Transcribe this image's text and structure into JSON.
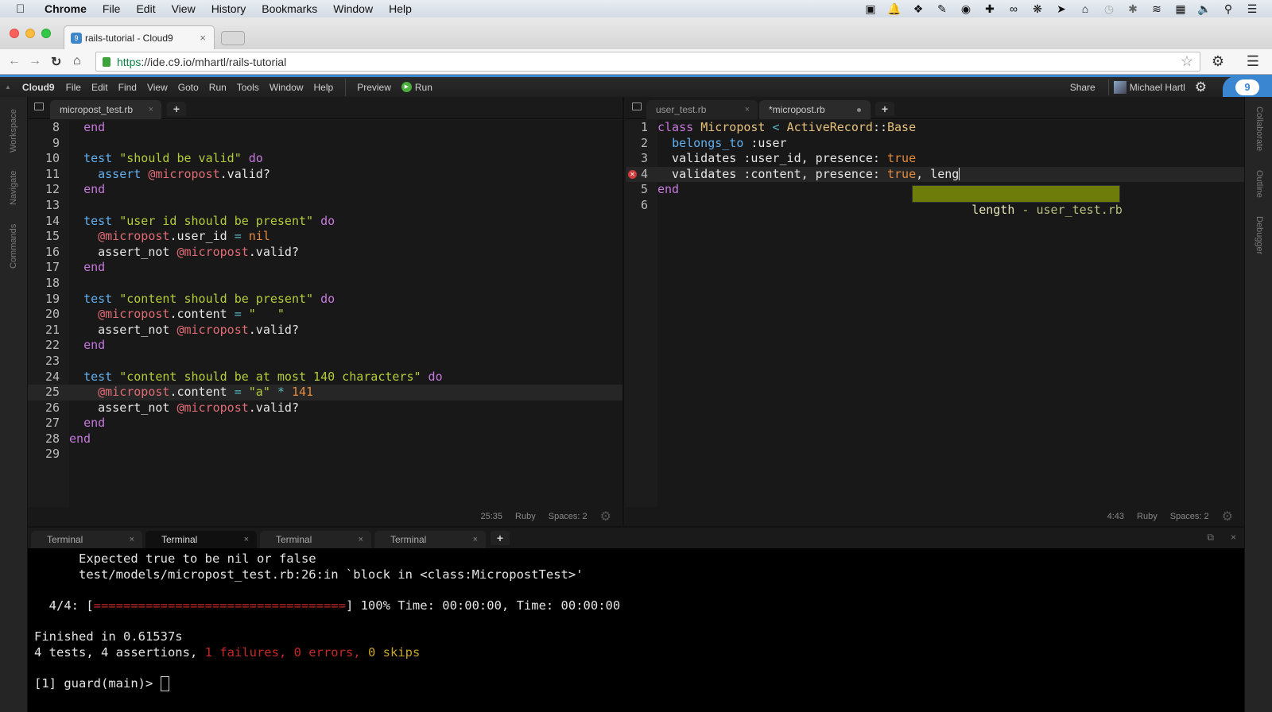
{
  "mac_menubar": {
    "app": "Chrome",
    "items": [
      "File",
      "Edit",
      "View",
      "History",
      "Bookmarks",
      "Window",
      "Help"
    ],
    "status_icons": [
      "camera-icon",
      "bell-icon",
      "dropbox-icon",
      "tools-icon",
      "bowl-icon",
      "plus-icon",
      "infinity-icon",
      "paw-icon",
      "arrow-icon",
      "home-icon",
      "time-machine-icon",
      "bluetooth-icon",
      "wifi-icon",
      "calendar-icon",
      "volume-icon",
      "search-icon",
      "list-icon"
    ]
  },
  "browser": {
    "tab_title": "rails-tutorial - Cloud9",
    "url_scheme": "https",
    "url_rest": "://ide.c9.io/mhartl/rails-tutorial"
  },
  "ide": {
    "brand": "Cloud9",
    "menu": [
      "File",
      "Edit",
      "Find",
      "View",
      "Goto",
      "Run",
      "Tools",
      "Window",
      "Help"
    ],
    "preview_label": "Preview",
    "run_label": "Run",
    "share_label": "Share",
    "user_name": "Michael Hartl",
    "left_rail": [
      "Workspace",
      "Navigate",
      "Commands"
    ],
    "right_rail": [
      "Collaborate",
      "Outline",
      "Debugger"
    ]
  },
  "left_pane": {
    "tabs": [
      {
        "label": "micropost_test.rb",
        "active": true
      }
    ],
    "status": {
      "cursor": "25:35",
      "mode": "Ruby",
      "indent": "Spaces: 2"
    },
    "line_numbers": [
      "8",
      "9",
      "10",
      "11",
      "12",
      "13",
      "14",
      "15",
      "16",
      "17",
      "18",
      "19",
      "20",
      "21",
      "22",
      "23",
      "24",
      "25",
      "26",
      "27",
      "28",
      "29"
    ],
    "highlighted_line": "25"
  },
  "right_pane": {
    "tabs": [
      {
        "label": "user_test.rb",
        "active": false
      },
      {
        "label": "*micropost.rb",
        "active": true
      }
    ],
    "status": {
      "cursor": "4:43",
      "mode": "Ruby",
      "indent": "Spaces: 2"
    },
    "line_numbers": [
      "1",
      "2",
      "3",
      "4",
      "5",
      "6"
    ],
    "error_line": "4",
    "autocomplete": {
      "word": "length",
      "meta": " - user_test.rb"
    }
  },
  "terminal": {
    "tabs": [
      "Terminal",
      "Terminal",
      "Terminal",
      "Terminal"
    ],
    "active_tab": 1,
    "lines": {
      "l1": "      Expected true to be nil or false",
      "l2": "      test/models/micropost_test.rb:26:in `block in <class:MicropostTest>'",
      "progress_prefix": "  4/4: [",
      "progress_bar": "==================================",
      "progress_suffix": "] 100% Time: 00:00:00, Time: 00:00:00",
      "finished": "Finished in 0.61537s",
      "summary_prefix": "4 tests, 4 assertions, ",
      "summary_fail": "1 failures, 0 errors, ",
      "summary_skip": "0 skips",
      "prompt": "[1] guard(main)> "
    },
    "progress_percent": 100
  }
}
